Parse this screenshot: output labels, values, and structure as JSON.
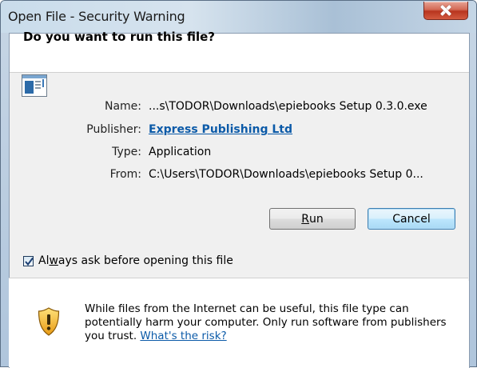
{
  "window": {
    "title": "Open File - Security Warning"
  },
  "header": {
    "question": "Do you want to run this file?"
  },
  "file_info": {
    "name_label": "Name:",
    "name_value": "...s\\TODOR\\Downloads\\epiebooks Setup 0.3.0.exe",
    "publisher_label": "Publisher:",
    "publisher_value": "Express Publishing Ltd",
    "type_label": "Type:",
    "type_value": "Application",
    "from_label": "From:",
    "from_value": "C:\\Users\\TODOR\\Downloads\\epiebooks Setup 0..."
  },
  "buttons": {
    "run_prefix": "",
    "run_mnemonic": "R",
    "run_rest": "un",
    "cancel": "Cancel"
  },
  "checkbox": {
    "label_prefix": "Al",
    "label_mnemonic": "w",
    "label_rest": "ays ask before opening this file",
    "checked": true
  },
  "warning": {
    "text": "While files from the Internet can be useful, this file type can potentially harm your computer. Only run software from publishers you trust. ",
    "link": "What's the risk?"
  },
  "colors": {
    "link": "#0b5aa8",
    "default_button_border": "#3c7fb1"
  },
  "icons": {
    "close": "close-icon",
    "file": "application-file-icon",
    "shield": "security-shield-icon",
    "check": "checkmark-icon"
  }
}
